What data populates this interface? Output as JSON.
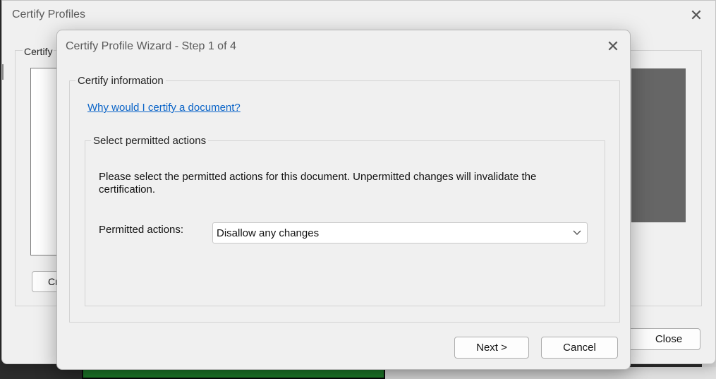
{
  "back_window": {
    "title": "Certify Profiles",
    "group_label": "Certify",
    "left_button_label": "Cr",
    "close_button_label": "Close",
    "close_glyph": "✕"
  },
  "wizard": {
    "title": "Certify Profile Wizard - Step 1 of 4",
    "close_glyph": "✕",
    "certify_group_label": "Certify information",
    "why_link": "Why would I certify a document?",
    "actions_group_label": "Select permitted actions",
    "description": "Please select the permitted actions for this document. Unpermitted changes will invalidate the certification.",
    "permitted_label": "Permitted actions:",
    "permitted_value": "Disallow any changes",
    "next_label": "Next >",
    "cancel_label": "Cancel"
  },
  "colors": {
    "link": "#0a64c8",
    "dialog_bg": "#f0f0f0",
    "preview_gray": "#666666"
  }
}
